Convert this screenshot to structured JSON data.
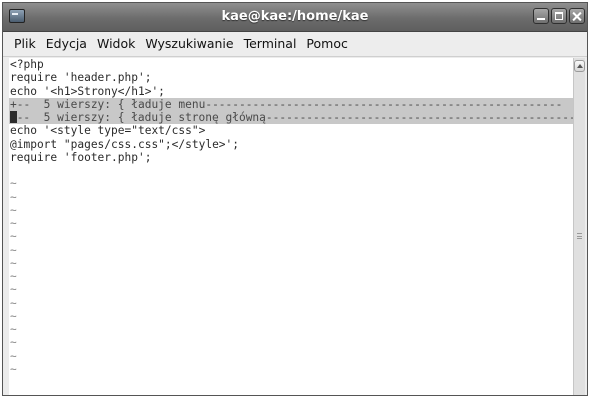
{
  "window": {
    "title": "kae@kae:/home/kae",
    "icon": "terminal-icon",
    "controls": [
      "minimize-icon",
      "maximize-icon",
      "close-icon"
    ]
  },
  "menu": [
    "Plik",
    "Edycja",
    "Widok",
    "Wyszukiwanie",
    "Terminal",
    "Pomoc"
  ],
  "editor": {
    "lines": [
      "<?php",
      "require 'header.php';",
      "echo '<h1>Strony</h1>';"
    ],
    "fold1": "+--  5 wierszy: { ładuje menu-----------------------------------------------------",
    "fold2_cursor": "+",
    "fold2": "--  5 wierszy: { ładuje stronę główną----------------------------------------------",
    "lines_after": [
      "echo '<style type=\"text/css\">",
      "@import \"pages/css.css\";</style>';",
      "require 'footer.php';",
      ""
    ],
    "tilde": "~",
    "tilde_count": 15
  },
  "colors": {
    "fold_background": "#c8c8c8",
    "titlebar": "#6c6c6c",
    "text": "#2b2b2b"
  }
}
